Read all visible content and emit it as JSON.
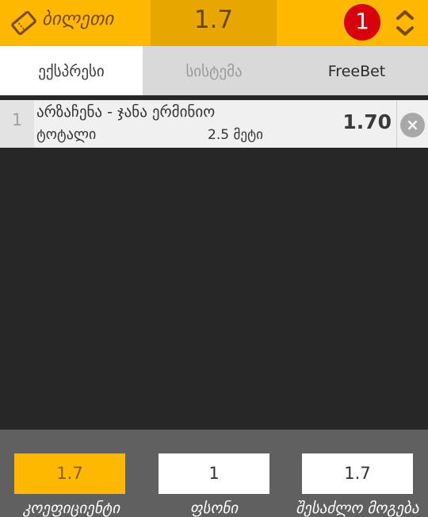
{
  "header": {
    "ticket_label": "ბილეთი",
    "total_odds": "1.7",
    "bet_count": "1"
  },
  "tabs": [
    {
      "label": "ექსპრესი"
    },
    {
      "label": "სისტემა"
    },
    {
      "label": "FreeBet"
    }
  ],
  "bet": {
    "index": "1",
    "match": "არზაჩენა - ჯანა ერმინიო",
    "market": "ტოტალი",
    "selection": "2.5 მეტი",
    "odds": "1.70",
    "remove_icon": "×"
  },
  "footer": {
    "coefficient": {
      "value": "1.7",
      "label": "კოეფიციენტი"
    },
    "stake": {
      "value": "1",
      "label": "ფსონი"
    },
    "possible_win": {
      "value": "1.7",
      "label": "შესაძლო მოგება"
    }
  },
  "colors": {
    "accent": "#ffb800",
    "badge": "#d9000d",
    "background": "#272727"
  }
}
